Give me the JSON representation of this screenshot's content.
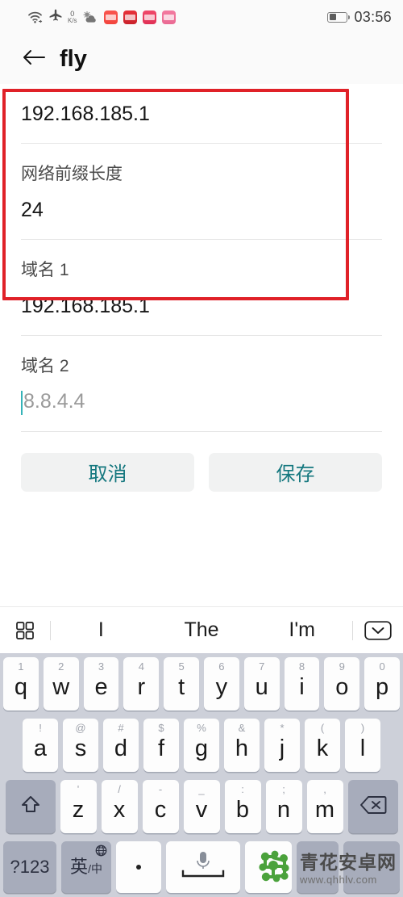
{
  "status_bar": {
    "wifi_icon": "wifi-icon",
    "airplane_icon": "airplane-mode-icon",
    "net_speed_value": "0",
    "net_speed_unit": "K/s",
    "weather_icon": "cloud-sun-icon",
    "app_icons": [
      "app-notification-icon-1",
      "app-notification-icon-2",
      "app-notification-icon-3",
      "app-notification-icon-4"
    ],
    "battery_icon": "battery-icon",
    "battery_level_pct": 42,
    "time": "03:56"
  },
  "header": {
    "back_icon": "back-arrow-icon",
    "title": "fly"
  },
  "form": {
    "fields": [
      {
        "label": "",
        "value": "192.168.185.1",
        "is_placeholder": false,
        "has_caret": false
      },
      {
        "label": "网络前缀长度",
        "value": "24",
        "is_placeholder": false,
        "has_caret": false
      },
      {
        "label": "域名 1",
        "value": "192.168.185.1",
        "is_placeholder": false,
        "has_caret": false
      },
      {
        "label": "域名 2",
        "value": "8.8.4.4",
        "is_placeholder": true,
        "has_caret": true
      }
    ],
    "highlight_color": "#e02128"
  },
  "actions": {
    "cancel_label": "取消",
    "save_label": "保存",
    "accent_color": "#15787f"
  },
  "keyboard": {
    "suggestion_bar": {
      "grid_icon": "grid-menu-icon",
      "suggestions": [
        "I",
        "The",
        "I'm"
      ],
      "collapse_icon": "chevron-down-boxed-icon"
    },
    "row1": [
      {
        "main": "q",
        "hint": "1"
      },
      {
        "main": "w",
        "hint": "2"
      },
      {
        "main": "e",
        "hint": "3"
      },
      {
        "main": "r",
        "hint": "4"
      },
      {
        "main": "t",
        "hint": "5"
      },
      {
        "main": "y",
        "hint": "6"
      },
      {
        "main": "u",
        "hint": "7"
      },
      {
        "main": "i",
        "hint": "8"
      },
      {
        "main": "o",
        "hint": "9"
      },
      {
        "main": "p",
        "hint": "0"
      }
    ],
    "row2": [
      {
        "main": "a",
        "hint": "!"
      },
      {
        "main": "s",
        "hint": "@"
      },
      {
        "main": "d",
        "hint": "#"
      },
      {
        "main": "f",
        "hint": "$"
      },
      {
        "main": "g",
        "hint": "%"
      },
      {
        "main": "h",
        "hint": "&"
      },
      {
        "main": "j",
        "hint": "*"
      },
      {
        "main": "k",
        "hint": "("
      },
      {
        "main": "l",
        "hint": ")"
      }
    ],
    "row3": {
      "shift_icon": "shift-arrow-icon",
      "keys": [
        {
          "main": "z",
          "hint": "'"
        },
        {
          "main": "x",
          "hint": "/"
        },
        {
          "main": "c",
          "hint": "-"
        },
        {
          "main": "v",
          "hint": "_"
        },
        {
          "main": "b",
          "hint": ":"
        },
        {
          "main": "n",
          "hint": ";"
        },
        {
          "main": "m",
          "hint": ","
        }
      ],
      "backspace_icon": "backspace-icon"
    },
    "row4": {
      "symbols_label": "?123",
      "lang_label": "英",
      "lang_sub_label": "中",
      "globe_icon": "globe-icon",
      "period_label": ".",
      "space_mic_icon": "microphone-icon",
      "space_label": ""
    }
  },
  "watermark": {
    "logo_icon": "site-logo-icon",
    "site_name": "青花安卓网",
    "site_url": "www.qhhlv.com"
  }
}
